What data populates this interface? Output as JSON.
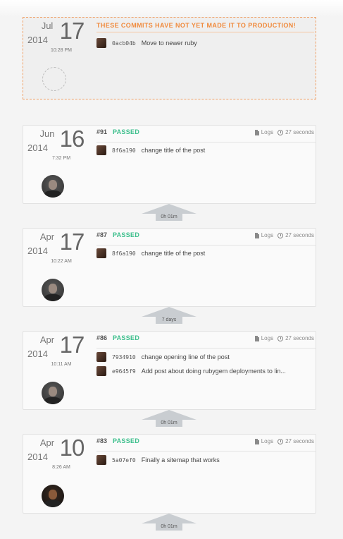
{
  "pending": {
    "month": "Jul",
    "day": "17",
    "year": "2014",
    "time": "10:28 PM",
    "warning": "THESE COMMITS HAVE NOT YET MADE IT TO PRODUCTION!",
    "commits": [
      {
        "sha": "0acb04b",
        "message": "Move to newer ruby"
      }
    ]
  },
  "builds": [
    {
      "month": "Jun",
      "day": "16",
      "year": "2014",
      "time": "7:32 PM",
      "number": "#91",
      "status": "PASSED",
      "logs": "Logs",
      "duration": "27 seconds",
      "commits": [
        {
          "sha": "8f6a190",
          "message": "change title of the post"
        }
      ]
    },
    {
      "month": "Apr",
      "day": "17",
      "year": "2014",
      "time": "10:22 AM",
      "number": "#87",
      "status": "PASSED",
      "logs": "Logs",
      "duration": "27 seconds",
      "commits": [
        {
          "sha": "8f6a190",
          "message": "change title of the post"
        }
      ]
    },
    {
      "month": "Apr",
      "day": "17",
      "year": "2014",
      "time": "10:11 AM",
      "number": "#86",
      "status": "PASSED",
      "logs": "Logs",
      "duration": "27 seconds",
      "commits": [
        {
          "sha": "7934910",
          "message": "change opening line of the post"
        },
        {
          "sha": "e9645f9",
          "message": "Add post about doing rubygem deployments to lin..."
        }
      ]
    },
    {
      "month": "Apr",
      "day": "10",
      "year": "2014",
      "time": "8:26 AM",
      "number": "#83",
      "status": "PASSED",
      "logs": "Logs",
      "duration": "27 seconds",
      "commits": [
        {
          "sha": "5a07ef0",
          "message": "Finally a sitemap that works"
        }
      ]
    }
  ],
  "gaps": [
    "0h 01m",
    "7 days",
    "0h 01m",
    "0h 01m"
  ],
  "colors": {
    "passed": "#3cbf8c",
    "warning": "#f08a3c",
    "connector": "#c9cdd1"
  },
  "icons": {
    "logs": "file-icon",
    "duration": "clock-icon"
  }
}
